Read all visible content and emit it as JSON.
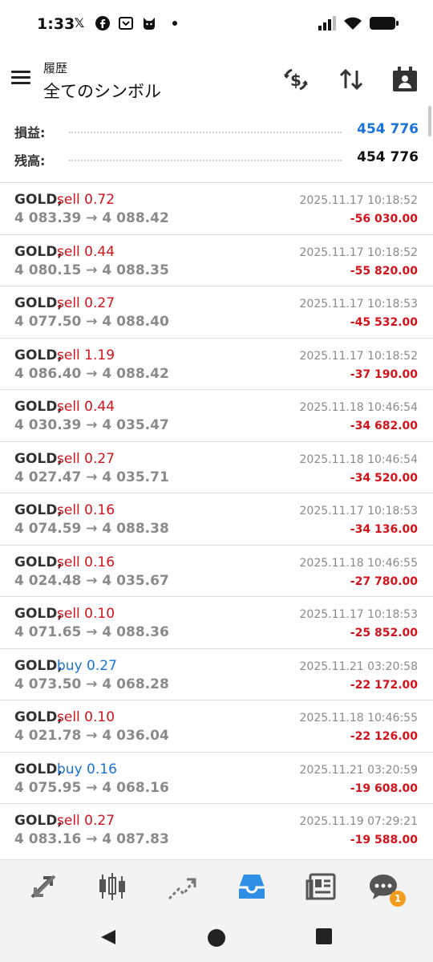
{
  "status_bar": {
    "time": "1:33",
    "left_icons": [
      "x-icon",
      "facebook-icon",
      "bookmark-icon",
      "cat-icon",
      "dot-icon"
    ],
    "right_icons": [
      "signal-icon",
      "wifi-icon",
      "battery-icon"
    ]
  },
  "app_bar": {
    "subtitle": "履歴",
    "title": "全てのシンボル"
  },
  "summary": {
    "profit_label": "損益:",
    "profit_value": "454 776",
    "balance_label": "残高:",
    "balance_value": "454 776",
    "profit_color": "#1a73d9"
  },
  "deals": [
    {
      "symbol": "GOLD,",
      "side": "sell 0.72",
      "type": "sell",
      "prices": "4 083.39 → 4 088.42",
      "date": "2025.11.17 10:18:52",
      "profit": "-56 030.00"
    },
    {
      "symbol": "GOLD,",
      "side": "sell 0.44",
      "type": "sell",
      "prices": "4 080.15 → 4 088.35",
      "date": "2025.11.17 10:18:52",
      "profit": "-55 820.00"
    },
    {
      "symbol": "GOLD,",
      "side": "sell 0.27",
      "type": "sell",
      "prices": "4 077.50 → 4 088.40",
      "date": "2025.11.17 10:18:53",
      "profit": "-45 532.00"
    },
    {
      "symbol": "GOLD,",
      "side": "sell 1.19",
      "type": "sell",
      "prices": "4 086.40 → 4 088.42",
      "date": "2025.11.17 10:18:52",
      "profit": "-37 190.00"
    },
    {
      "symbol": "GOLD,",
      "side": "sell 0.44",
      "type": "sell",
      "prices": "4 030.39 → 4 035.47",
      "date": "2025.11.18 10:46:54",
      "profit": "-34 682.00"
    },
    {
      "symbol": "GOLD,",
      "side": "sell 0.27",
      "type": "sell",
      "prices": "4 027.47 → 4 035.71",
      "date": "2025.11.18 10:46:54",
      "profit": "-34 520.00"
    },
    {
      "symbol": "GOLD,",
      "side": "sell 0.16",
      "type": "sell",
      "prices": "4 074.59 → 4 088.38",
      "date": "2025.11.17 10:18:53",
      "profit": "-34 136.00"
    },
    {
      "symbol": "GOLD,",
      "side": "sell 0.16",
      "type": "sell",
      "prices": "4 024.48 → 4 035.67",
      "date": "2025.11.18 10:46:55",
      "profit": "-27 780.00"
    },
    {
      "symbol": "GOLD,",
      "side": "sell 0.10",
      "type": "sell",
      "prices": "4 071.65 → 4 088.36",
      "date": "2025.11.17 10:18:53",
      "profit": "-25 852.00"
    },
    {
      "symbol": "GOLD,",
      "side": "buy 0.27",
      "type": "buy",
      "prices": "4 073.50 → 4 068.28",
      "date": "2025.11.21 03:20:58",
      "profit": "-22 172.00"
    },
    {
      "symbol": "GOLD,",
      "side": "sell 0.10",
      "type": "sell",
      "prices": "4 021.78 → 4 036.04",
      "date": "2025.11.18 10:46:55",
      "profit": "-22 126.00"
    },
    {
      "symbol": "GOLD,",
      "side": "buy 0.16",
      "type": "buy",
      "prices": "4 075.95 → 4 068.16",
      "date": "2025.11.21 03:20:59",
      "profit": "-19 608.00"
    },
    {
      "symbol": "GOLD,",
      "side": "sell 0.27",
      "type": "sell",
      "prices": "4 083.16 → 4 087.83",
      "date": "2025.11.19 07:29:21",
      "profit": "-19 588.00"
    }
  ],
  "colors": {
    "sell": "#d3131b",
    "buy": "#1a73d9",
    "loss": "#d3131b",
    "active_tab": "#2f8fe6",
    "badge": "#f29b1d"
  },
  "bottom_nav": {
    "items": [
      "quotes-icon",
      "chart-icon",
      "trade-icon",
      "history-icon",
      "news-icon",
      "chat-icon"
    ],
    "active": "history-icon",
    "chat_badge": "1"
  },
  "system_nav": [
    "back-icon",
    "home-icon",
    "recents-icon"
  ]
}
